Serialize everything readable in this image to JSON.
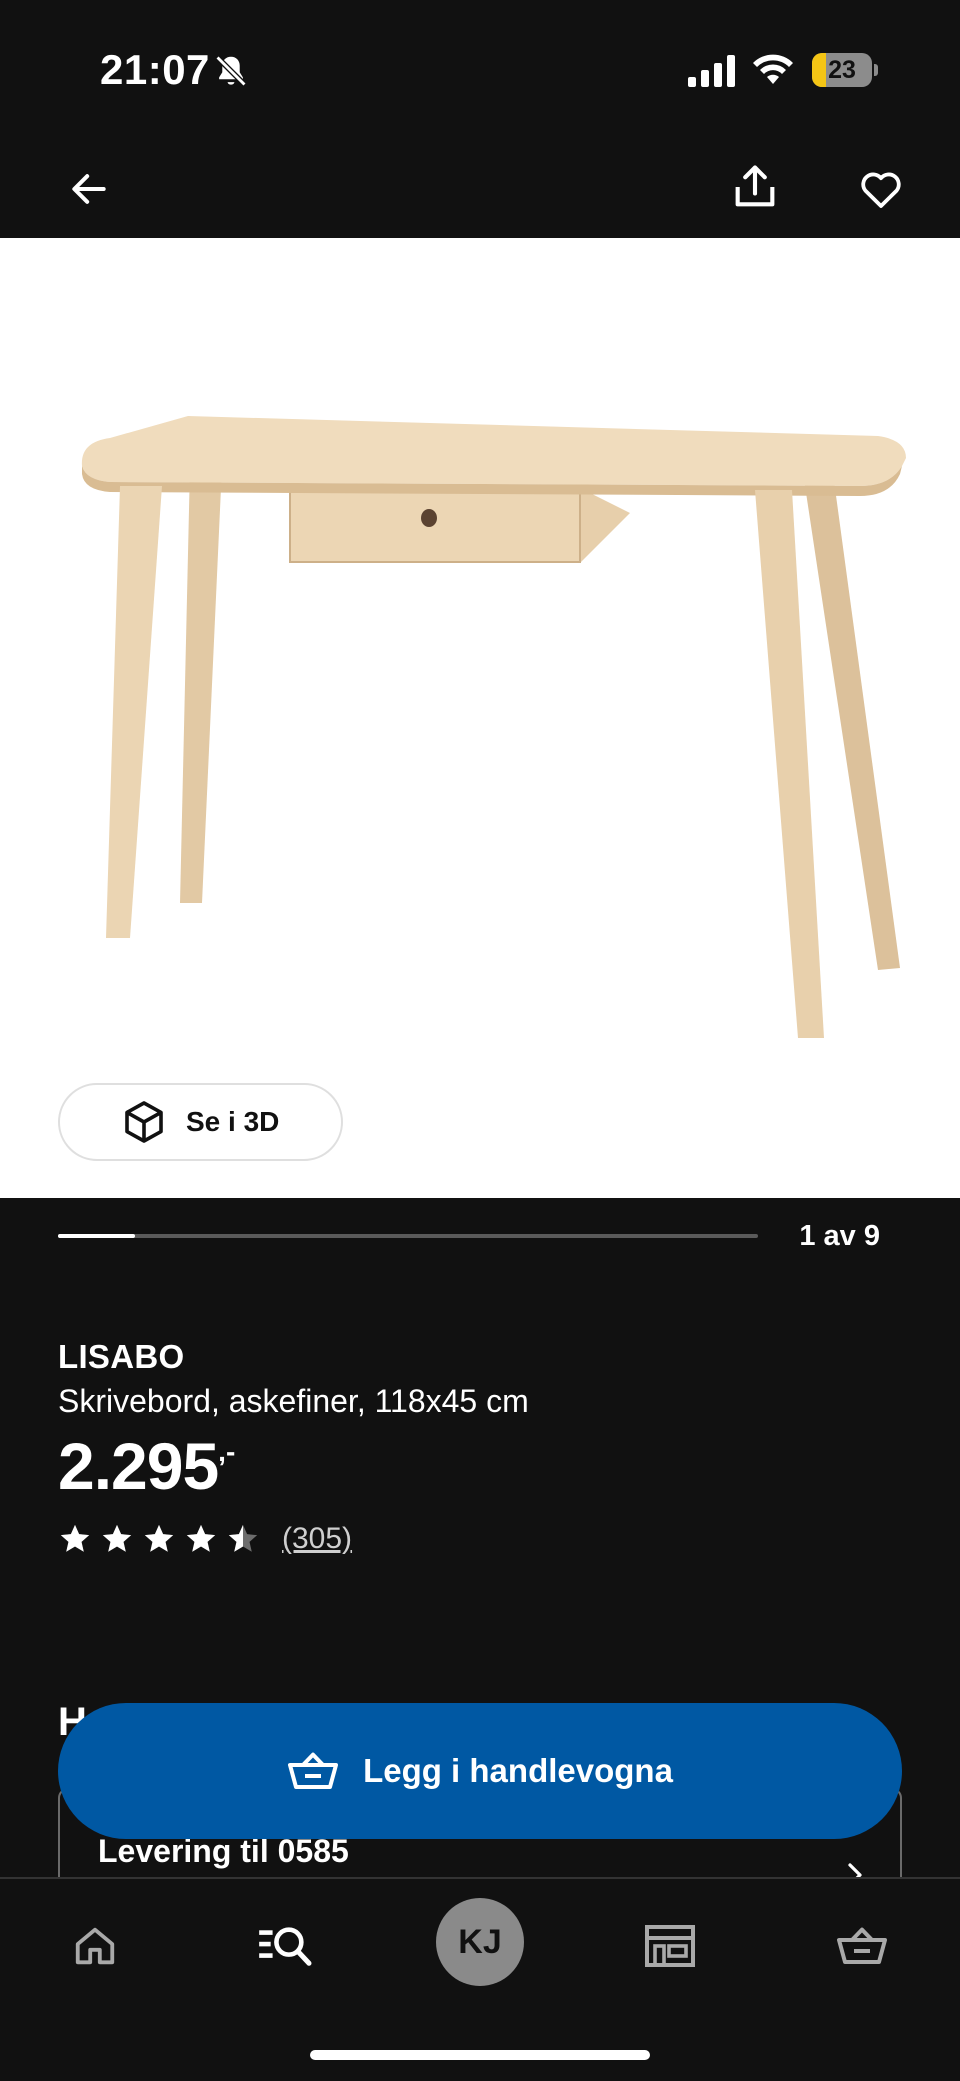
{
  "status_bar": {
    "time": "21:07",
    "battery": "23",
    "battery_level": 0.23
  },
  "product": {
    "name": "LISABO",
    "description": "Skrivebord, askefiner, 118x45 cm",
    "price": "2.295",
    "price_suffix": ",-",
    "rating": 4.5,
    "review_count": "(305)"
  },
  "gallery": {
    "view_3d_label": "Se i 3D",
    "counter": "1 av 9",
    "progress": 0.11
  },
  "delivery": {
    "heading_partial": "H",
    "text": "Levering til 0585"
  },
  "actions": {
    "add_to_cart": "Legg i handlevogna"
  },
  "tab_bar": {
    "profile_initials": "KJ"
  },
  "colors": {
    "background": "#111111",
    "primary_button": "#0058a3",
    "battery": "#f4c515"
  },
  "icons": [
    "bell-off-icon",
    "signal-icon",
    "wifi-icon",
    "back-arrow-icon",
    "share-icon",
    "heart-icon",
    "cube-icon",
    "star-icon",
    "cart-icon",
    "home-icon",
    "search-icon",
    "store-icon"
  ]
}
